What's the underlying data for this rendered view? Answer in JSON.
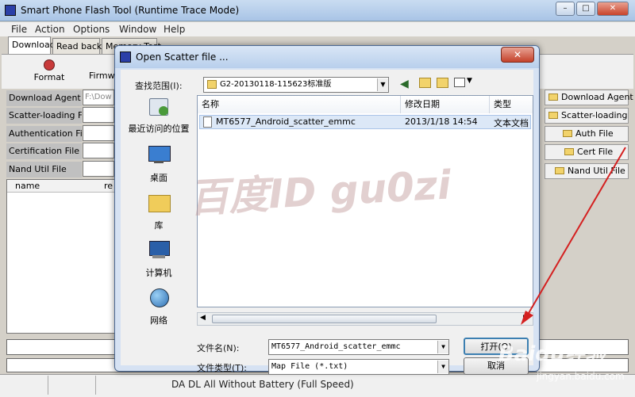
{
  "window": {
    "title": "Smart Phone Flash Tool (Runtime Trace Mode)",
    "controls": [
      "–",
      "□",
      "✕"
    ]
  },
  "menu": [
    "File",
    "Action",
    "Options",
    "Window",
    "Help"
  ],
  "tabs": [
    "Download",
    "Read back",
    "Memory Test"
  ],
  "toolbar": {
    "format": "Format",
    "firmware": "Firmware"
  },
  "left_fields": [
    {
      "label": "Download Agent",
      "value": "F:\\Dow"
    },
    {
      "label": "Scatter-loading File",
      "value": ""
    },
    {
      "label": "Authentication File",
      "value": ""
    },
    {
      "label": "Certification File",
      "value": ""
    },
    {
      "label": "Nand Util File",
      "value": ""
    }
  ],
  "list_headers": [
    "name",
    "re"
  ],
  "right_buttons": [
    "Download Agent",
    "Scatter-loading",
    "Auth File",
    "Cert File",
    "Nand Util File"
  ],
  "status_bar": {
    "text": "DA DL All Without Battery (Full Speed)"
  },
  "dialog": {
    "title": "Open Scatter file ...",
    "close": "✕",
    "lookin_label": "查找范围(I):",
    "lookin_value": "G2-20130118-115623标准版",
    "places": [
      {
        "label": "最近访问的位置",
        "icon": "recent-places-icon"
      },
      {
        "label": "桌面",
        "icon": "desktop-icon"
      },
      {
        "label": "库",
        "icon": "libraries-icon"
      },
      {
        "label": "计算机",
        "icon": "computer-icon"
      },
      {
        "label": "网络",
        "icon": "network-icon"
      }
    ],
    "columns": [
      "名称",
      "修改日期",
      "类型"
    ],
    "files": [
      {
        "name": "MT6577_Android_scatter_emmc",
        "date": "2013/1/18 14:54",
        "type": "文本文档"
      }
    ],
    "filename_label": "文件名(N):",
    "filename_value": "MT6577_Android_scatter_emmc",
    "filetype_label": "文件类型(T):",
    "filetype_value": "Map File (*.txt)",
    "open_button": "打开(O)",
    "cancel_button": "取消"
  },
  "watermark": "百度ID gu0zi",
  "baidu": {
    "logo": "Baidu经验",
    "url": "jingyan.baidu.com"
  }
}
